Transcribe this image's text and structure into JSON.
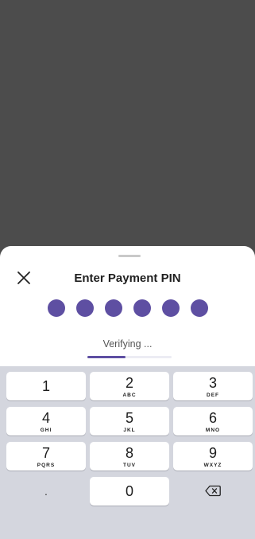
{
  "header": {
    "title": "Enter Payment PIN"
  },
  "pin": {
    "length": 6,
    "filled": 6,
    "dot_color": "#5e4fa2"
  },
  "status": {
    "text": "Verifying ...",
    "progress": 0.45,
    "accent": "#5e4fa2"
  },
  "keypad": {
    "rows": [
      [
        {
          "digit": "1",
          "letters": ""
        },
        {
          "digit": "2",
          "letters": "ABC"
        },
        {
          "digit": "3",
          "letters": "DEF"
        }
      ],
      [
        {
          "digit": "4",
          "letters": "GHI"
        },
        {
          "digit": "5",
          "letters": "JKL"
        },
        {
          "digit": "6",
          "letters": "MNO"
        }
      ],
      [
        {
          "digit": "7",
          "letters": "PQRS"
        },
        {
          "digit": "8",
          "letters": "TUV"
        },
        {
          "digit": "9",
          "letters": "WXYZ"
        }
      ]
    ],
    "bottom": {
      "dot_label": ".",
      "zero": "0"
    }
  }
}
